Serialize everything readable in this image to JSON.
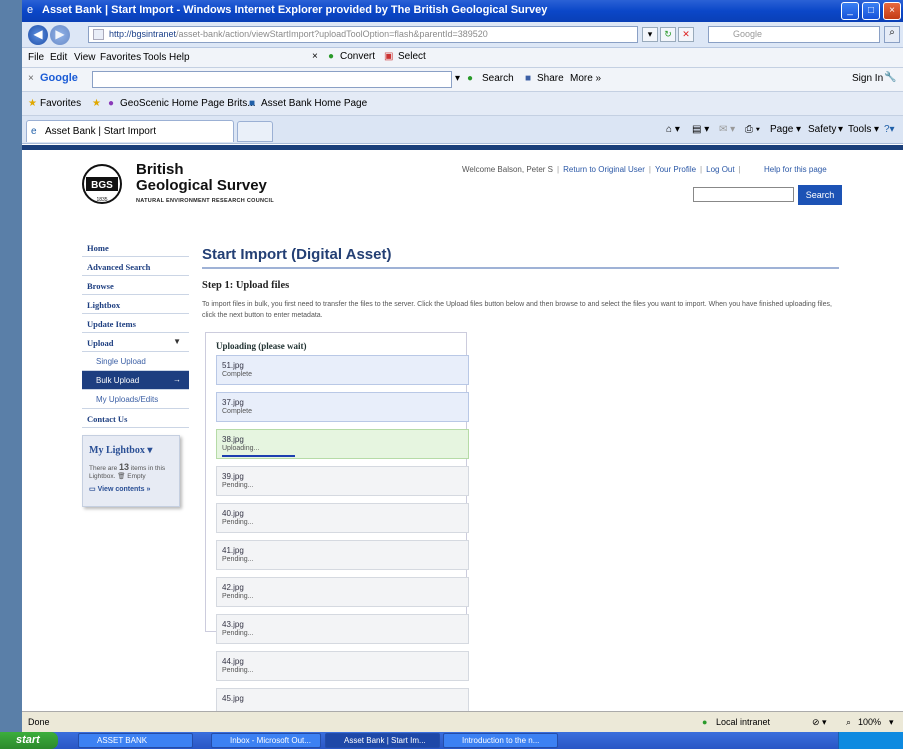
{
  "window": {
    "title": "Asset Bank | Start Import - Windows Internet Explorer provided by The British Geological Survey",
    "url_host": "http://bgsintranet",
    "url_path": "/asset-bank/action/viewStartImport?uploadToolOption=flash&parentId=389520",
    "search_placeholder": "Google"
  },
  "menubar": {
    "items": [
      "File",
      "Edit",
      "View",
      "Favorites",
      "Tools",
      "Help"
    ],
    "convert": "Convert",
    "select": "Select"
  },
  "googlebar": {
    "logo": "Google",
    "search": "Search",
    "share": "Share",
    "more": "More »",
    "signin": "Sign In"
  },
  "favorites": {
    "label": "Favorites",
    "items": [
      "GeoScenic Home Page Brits...",
      "Asset Bank Home Page"
    ]
  },
  "tab": {
    "title": "Asset Bank | Start Import",
    "tools": [
      "Page",
      "Safety",
      "Tools"
    ]
  },
  "site": {
    "brand_line1": "British",
    "brand_line2": "Geological Survey",
    "brand_line3": "NATURAL ENVIRONMENT RESEARCH COUNCIL",
    "logo_text": "BGS",
    "logo_year": "1835",
    "welcome": "Welcome Balson, Peter S",
    "links": [
      "Return to Original User",
      "Your Profile",
      "Log Out"
    ],
    "help": "Help for this page",
    "search_button": "Search"
  },
  "sidebar": {
    "items": [
      {
        "label": "Home"
      },
      {
        "label": "Advanced Search"
      },
      {
        "label": "Browse"
      },
      {
        "label": "Lightbox"
      },
      {
        "label": "Update Items"
      },
      {
        "label": "Upload"
      },
      {
        "label": "Single Upload"
      },
      {
        "label": "Bulk Upload"
      },
      {
        "label": "My Uploads/Edits"
      },
      {
        "label": "Contact Us"
      }
    ]
  },
  "lightbox_widget": {
    "title": "My Lightbox",
    "text_prefix": "There are",
    "count": "13",
    "text_suffix": "items in this Lightbox.",
    "empty": "Empty",
    "view": "View contents »"
  },
  "main": {
    "heading": "Start Import (Digital Asset)",
    "step": "Step 1: Upload files",
    "instructions": "To import files in bulk, you first need to transfer the files to the server. Click the Upload files button below and then browse to and select the files you want to import. When you have finished uploading files, click the next button to enter metadata.",
    "upload_title": "Uploading (please wait)",
    "files": [
      {
        "name": "51.jpg",
        "status": "Complete",
        "state": "complete"
      },
      {
        "name": "37.jpg",
        "status": "Complete",
        "state": "complete"
      },
      {
        "name": "38.jpg",
        "status": "Uploading...",
        "state": "uploading",
        "progress": 0.3
      },
      {
        "name": "39.jpg",
        "status": "Pending...",
        "state": "pending"
      },
      {
        "name": "40.jpg",
        "status": "Pending...",
        "state": "pending"
      },
      {
        "name": "41.jpg",
        "status": "Pending...",
        "state": "pending"
      },
      {
        "name": "42.jpg",
        "status": "Pending...",
        "state": "pending"
      },
      {
        "name": "43.jpg",
        "status": "Pending...",
        "state": "pending"
      },
      {
        "name": "44.jpg",
        "status": "Pending...",
        "state": "pending"
      },
      {
        "name": "45.jpg",
        "status": "",
        "state": "pending"
      }
    ]
  },
  "status": {
    "left": "Done",
    "zone": "Local intranet",
    "zoom": "100%"
  },
  "taskbar": {
    "start": "start",
    "items": [
      "ASSET BANK",
      "Inbox - Microsoft Out...",
      "Asset Bank | Start Im...",
      "Introduction to the n..."
    ]
  },
  "colors": {
    "nav_active": "#1d3e80",
    "heading": "#233f74",
    "complete_bg": "#e8eefa",
    "uploading_bg": "#e6f5e0",
    "progress": "#1d3fb0"
  }
}
